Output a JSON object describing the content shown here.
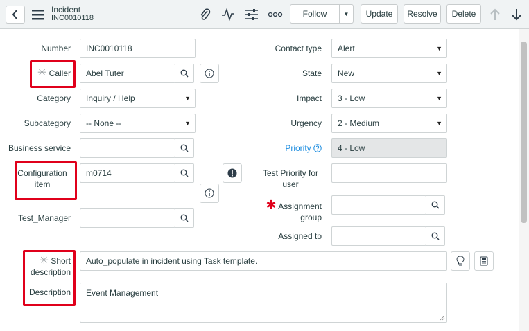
{
  "header": {
    "record_type": "Incident",
    "record_number": "INC0010118",
    "buttons": {
      "follow": "Follow",
      "update": "Update",
      "resolve": "Resolve",
      "delete": "Delete"
    }
  },
  "left": {
    "number": {
      "label": "Number",
      "value": "INC0010118"
    },
    "caller": {
      "label": "Caller",
      "value": "Abel Tuter"
    },
    "category": {
      "label": "Category",
      "value": "Inquiry / Help"
    },
    "subcategory": {
      "label": "Subcategory",
      "value": "-- None --"
    },
    "business_service": {
      "label": "Business service",
      "value": ""
    },
    "configuration_item": {
      "label_line1": "Configuration",
      "label_line2": "item",
      "value": "m0714"
    },
    "test_manager": {
      "label": "Test_Manager",
      "value": ""
    }
  },
  "right": {
    "contact_type": {
      "label": "Contact type",
      "value": "Alert"
    },
    "state": {
      "label": "State",
      "value": "New"
    },
    "impact": {
      "label": "Impact",
      "value": "3 - Low"
    },
    "urgency": {
      "label": "Urgency",
      "value": "2 - Medium"
    },
    "priority": {
      "label": "Priority",
      "value": "4 - Low"
    },
    "test_priority_user": {
      "label_line1": "Test Priority for",
      "label_line2": "user",
      "value": ""
    },
    "assignment_group": {
      "label_line1": "Assignment",
      "label_line2": "group",
      "value": ""
    },
    "assigned_to": {
      "label": "Assigned to",
      "value": ""
    }
  },
  "bottom": {
    "short_description": {
      "label_line1": "Short",
      "label_line2": "description",
      "value": "Auto_populate in incident using Task template."
    },
    "description": {
      "label": "Description",
      "value": "Event Management"
    }
  },
  "colors": {
    "highlight": "#e0001b",
    "link": "#1f8ee0",
    "header_bg": "#f0f3f4"
  }
}
